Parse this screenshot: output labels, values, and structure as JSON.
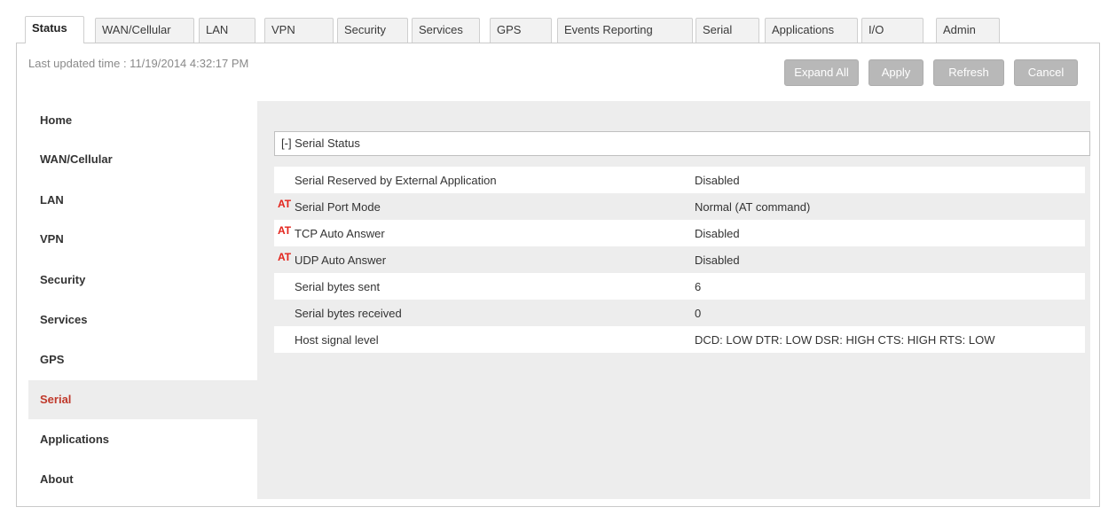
{
  "tabs": [
    {
      "label": "Status",
      "active": true
    },
    {
      "label": "WAN/Cellular",
      "active": false
    },
    {
      "label": "LAN",
      "active": false
    },
    {
      "label": "VPN",
      "active": false
    },
    {
      "label": "Security",
      "active": false
    },
    {
      "label": "Services",
      "active": false
    },
    {
      "label": "GPS",
      "active": false
    },
    {
      "label": "Events Reporting",
      "active": false
    },
    {
      "label": "Serial",
      "active": false
    },
    {
      "label": "Applications",
      "active": false
    },
    {
      "label": "I/O",
      "active": false
    },
    {
      "label": "Admin",
      "active": false
    }
  ],
  "header": {
    "last_updated": "Last updated time : 11/19/2014 4:32:17 PM"
  },
  "toolbar": {
    "expand_all": "Expand All",
    "apply": "Apply",
    "refresh": "Refresh",
    "cancel": "Cancel"
  },
  "sidebar": {
    "active": "Serial",
    "items": [
      {
        "label": "Home"
      },
      {
        "label": "WAN/Cellular"
      },
      {
        "label": "LAN"
      },
      {
        "label": "VPN"
      },
      {
        "label": "Security"
      },
      {
        "label": "Services"
      },
      {
        "label": "GPS"
      },
      {
        "label": "Serial"
      },
      {
        "label": "Applications"
      },
      {
        "label": "About"
      }
    ]
  },
  "section": {
    "title": "[-] Serial Status",
    "rows": [
      {
        "at": "",
        "label": "Serial Reserved by External Application",
        "value": "Disabled"
      },
      {
        "at": "AT",
        "label": "Serial Port Mode",
        "value": "Normal (AT command)"
      },
      {
        "at": "AT",
        "label": "TCP Auto Answer",
        "value": "Disabled"
      },
      {
        "at": "AT",
        "label": "UDP Auto Answer",
        "value": "Disabled"
      },
      {
        "at": "",
        "label": "Serial bytes sent",
        "value": "6"
      },
      {
        "at": "",
        "label": "Serial bytes received",
        "value": "0"
      },
      {
        "at": "",
        "label": "Host signal level",
        "value": "DCD: LOW DTR: LOW DSR: HIGH CTS: HIGH RTS: LOW"
      }
    ]
  },
  "colors": {
    "accent_red": "#c0392b",
    "at_marker": "#e3241c",
    "button_gray": "#b8b8b8",
    "panel_gray": "#ededed"
  }
}
